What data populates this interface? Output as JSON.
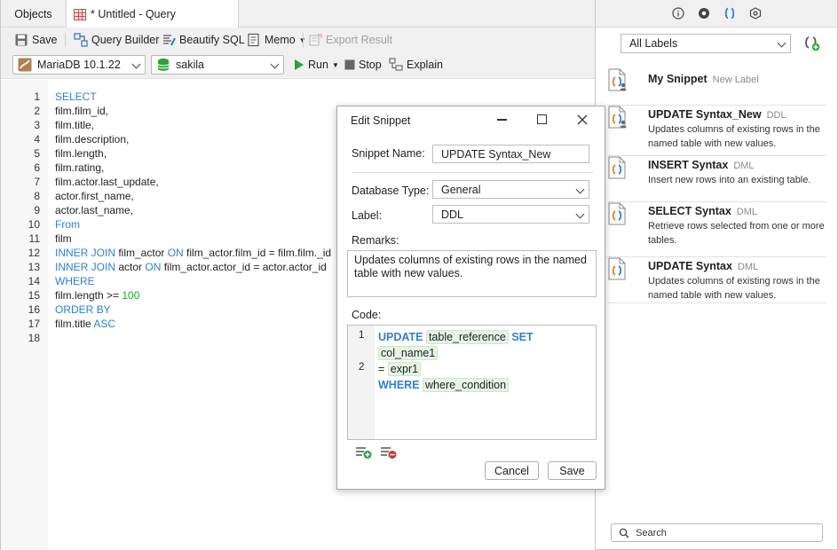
{
  "tabs": {
    "objects": "Objects",
    "query": "* Untitled - Query"
  },
  "toolbar": {
    "save": "Save",
    "query_builder": "Query Builder",
    "beautify": "Beautify SQL",
    "memo": "Memo",
    "export": "Export Result",
    "connection": "MariaDB 10.1.22",
    "database": "sakila",
    "run": "Run",
    "stop": "Stop",
    "explain": "Explain"
  },
  "editor": {
    "line_numbers": [
      "1",
      "2",
      "3",
      "4",
      "5",
      "6",
      "7",
      "8",
      "9",
      "10",
      "11",
      "12",
      "13",
      "14",
      "15",
      "16",
      "17",
      "18"
    ],
    "lines": [
      [
        {
          "t": "SELECT",
          "k": "kw"
        }
      ],
      [
        {
          "t": "film.film_id,"
        }
      ],
      [
        {
          "t": "film.title,"
        }
      ],
      [
        {
          "t": "film.description,"
        }
      ],
      [
        {
          "t": "film.length,"
        }
      ],
      [
        {
          "t": "film.rating,"
        }
      ],
      [
        {
          "t": "film.actor.last_update,"
        }
      ],
      [
        {
          "t": "actor.first_name,"
        }
      ],
      [
        {
          "t": "actor.last_name,"
        }
      ],
      [
        {
          "t": "From",
          "k": "kw"
        }
      ],
      [
        {
          "t": "film"
        }
      ],
      [
        {
          "t": "INNER JOIN",
          "k": "kw"
        },
        {
          "t": " film_actor "
        },
        {
          "t": "ON",
          "k": "kw"
        },
        {
          "t": " film_actor.film_id = film.film._id"
        }
      ],
      [
        {
          "t": "INNER JOIN",
          "k": "kw"
        },
        {
          "t": " actor "
        },
        {
          "t": "ON",
          "k": "kw"
        },
        {
          "t": " film_actor.actor_id = actor.actor_id"
        }
      ],
      [
        {
          "t": "WHERE",
          "k": "kw"
        }
      ],
      [
        {
          "t": "film.length >= "
        },
        {
          "t": "100",
          "k": "num"
        }
      ],
      [
        {
          "t": "ORDER BY",
          "k": "kw"
        }
      ],
      [
        {
          "t": "film.title "
        },
        {
          "t": "ASC",
          "k": "kw"
        }
      ],
      []
    ]
  },
  "panel": {
    "label_filter": "All Labels",
    "search_placeholder": "Search",
    "snippets": [
      {
        "title": "My Snippet",
        "category": "New Label",
        "desc": ""
      },
      {
        "title": "UPDATE Syntax_New",
        "category": "DDL",
        "desc": "Updates columns of existing rows in the named table with new values."
      },
      {
        "title": "INSERT Syntax",
        "category": "DML",
        "desc": "Insert new rows into an existing table."
      },
      {
        "title": "SELECT Syntax",
        "category": "DML",
        "desc": "Retrieve rows selected from one or more tables."
      },
      {
        "title": "UPDATE Syntax",
        "category": "DML",
        "desc": "Updates columns of existing rows in the named table with new values."
      }
    ]
  },
  "dialog": {
    "title": "Edit Snippet",
    "name_label": "Snippet Name:",
    "name_value": "UPDATE Syntax_New",
    "dbtype_label": "Database Type:",
    "dbtype_value": "General",
    "label_label": "Label:",
    "label_value": "DDL",
    "remarks_label": "Remarks:",
    "remarks_value": "Updates columns of existing rows in the named table with new values.",
    "code_label": "Code:",
    "code": {
      "kw_update": "UPDATE",
      "table_reference": "table_reference",
      "kw_set": "SET",
      "col_name1": "col_name1",
      "eq": "=",
      "expr1": "expr1",
      "kw_where": "WHERE",
      "where_condition": "where_condition",
      "ln1": "1",
      "ln2": "2"
    },
    "cancel": "Cancel",
    "save": "Save"
  }
}
